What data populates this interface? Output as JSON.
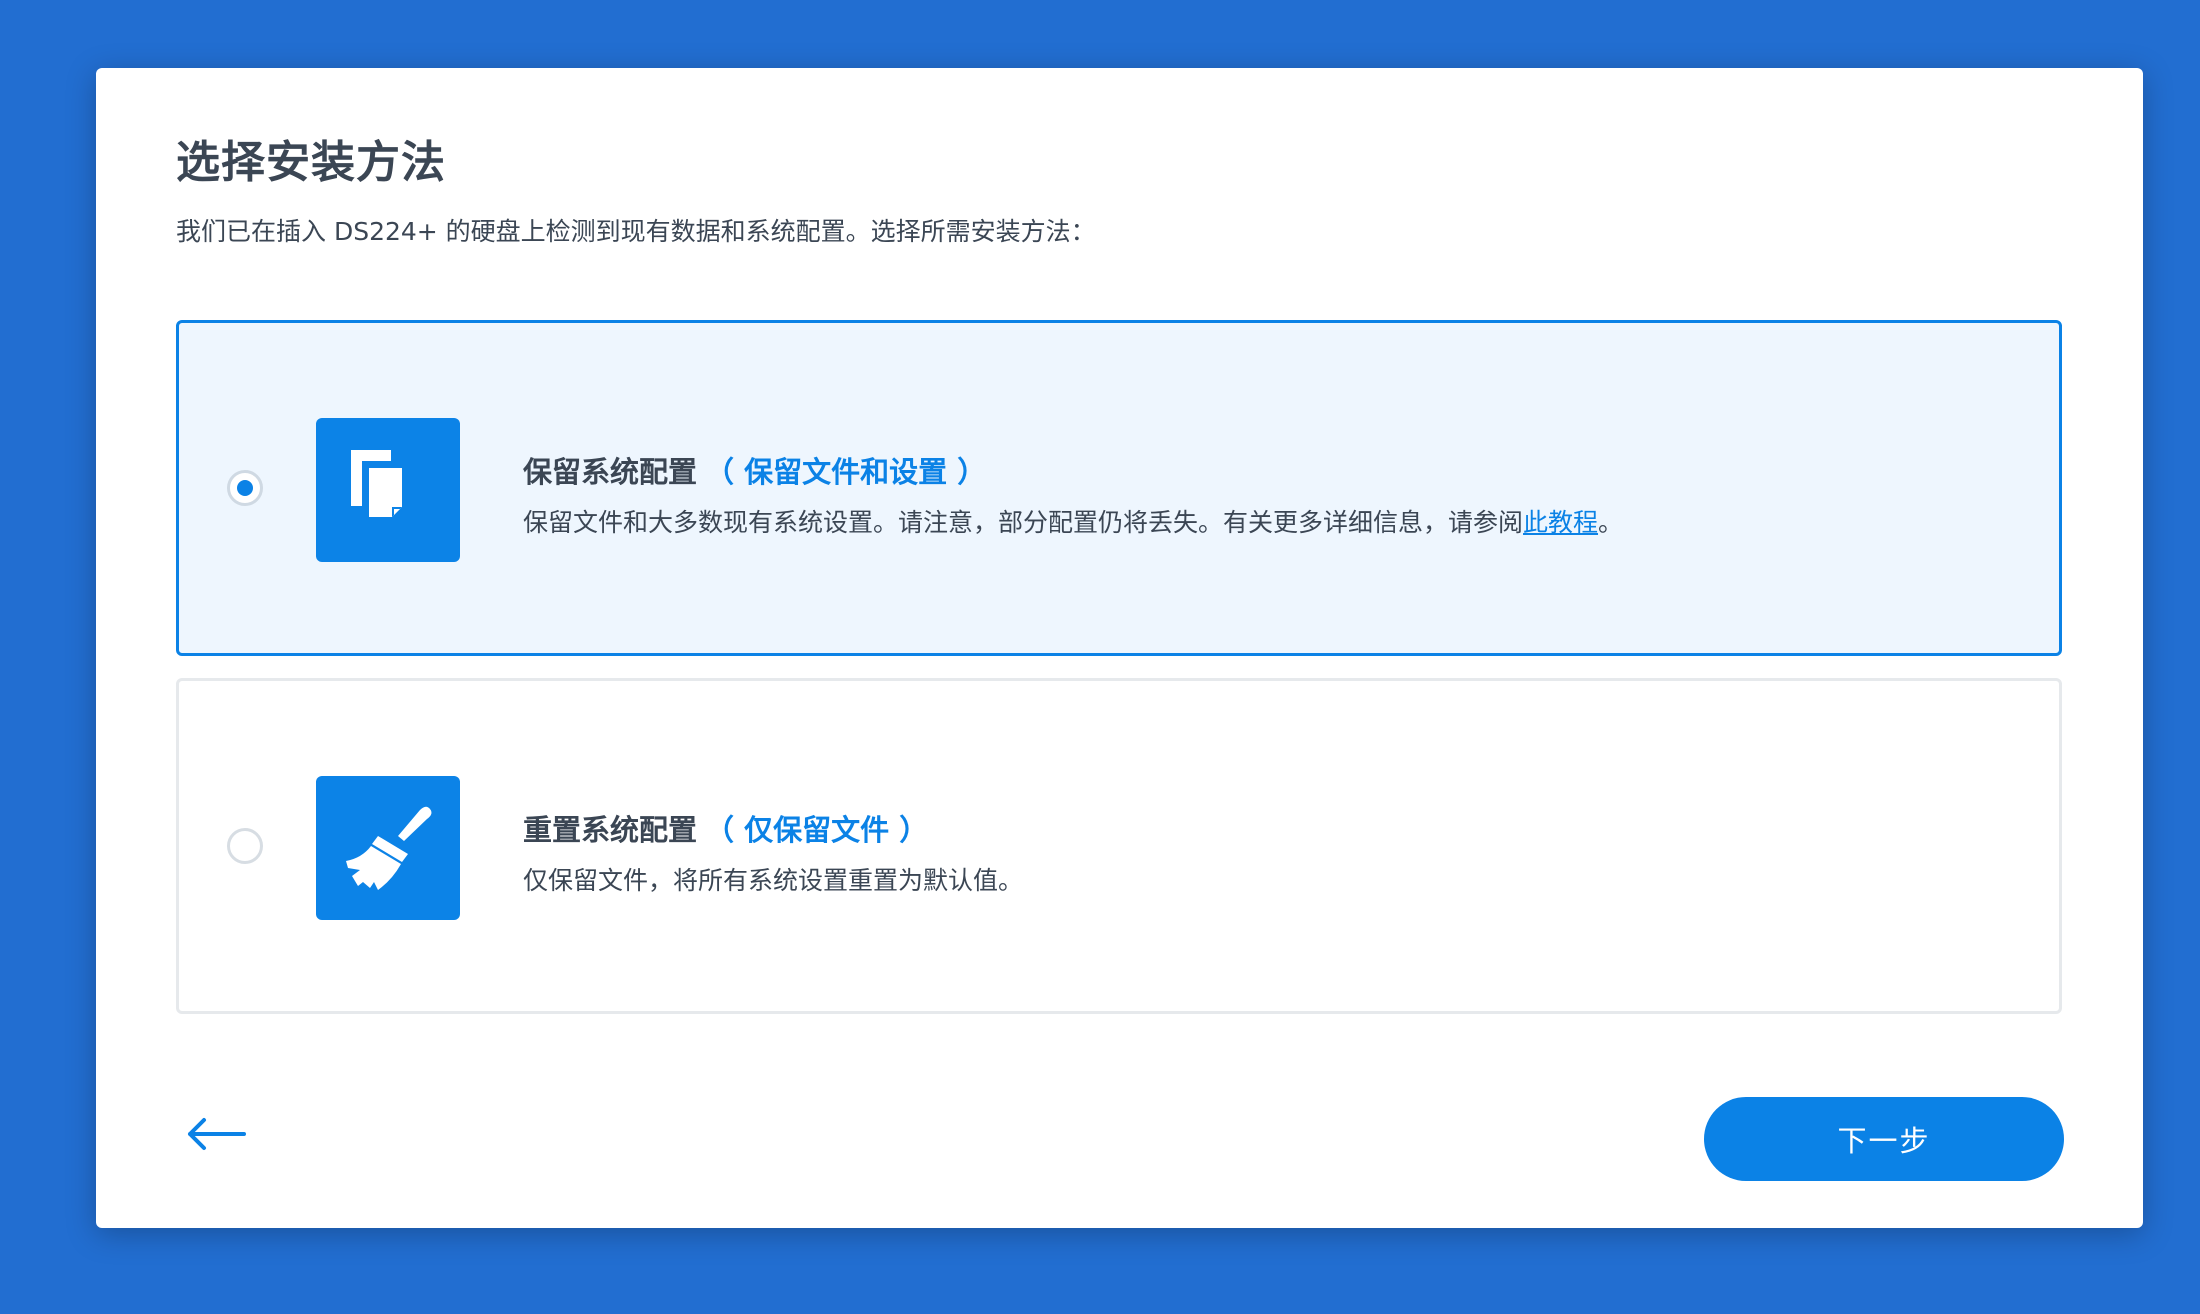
{
  "dialog": {
    "title": "选择安装方法",
    "subtitle": "我们已在插入 DS224+ 的硬盘上检测到现有数据和系统配置。选择所需安装方法："
  },
  "options": [
    {
      "title": "保留系统配置",
      "note": "（ 保留文件和设置 ）",
      "description": "保留文件和大多数现有系统设置。请注意，部分配置仍将丢失。有关更多详细信息，请参阅",
      "link_text": "此教程",
      "description_suffix": "。",
      "icon": "copy-files-icon",
      "selected": true
    },
    {
      "title": "重置系统配置",
      "note": "（ 仅保留文件 ）",
      "description": "仅保留文件，将所有系统设置重置为默认值。",
      "icon": "broom-icon",
      "selected": false
    }
  ],
  "footer": {
    "back_icon": "arrow-left-icon",
    "next_label": "下一步"
  },
  "colors": {
    "background": "#226ed1",
    "accent": "#0b82e6",
    "selected_bg": "#eef6fe",
    "text": "#3b4654"
  }
}
